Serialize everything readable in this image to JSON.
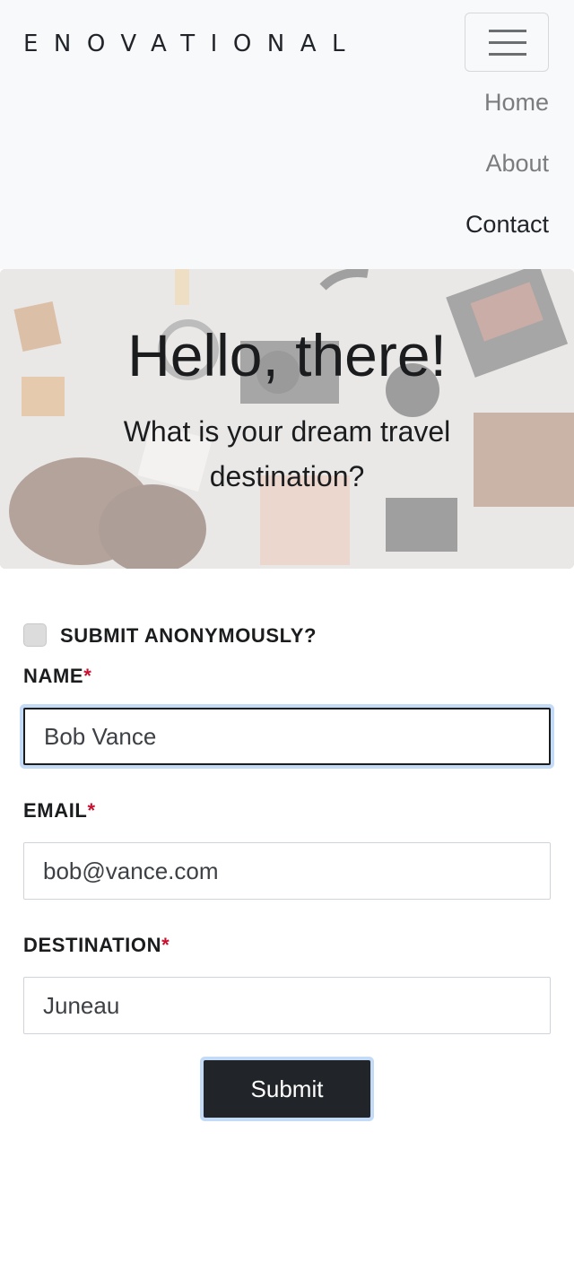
{
  "nav": {
    "brand": "ENOVATIONAL",
    "links": [
      "Home",
      "About",
      "Contact"
    ],
    "active_link": "Contact"
  },
  "hero": {
    "title": "Hello, there!",
    "subtitle": "What is your dream travel destination?"
  },
  "form": {
    "anonymous_label": "SUBMIT ANONYMOUSLY?",
    "anonymous_checked": false,
    "required_marker": "*",
    "name": {
      "label": "NAME",
      "value": "Bob Vance"
    },
    "email": {
      "label": "EMAIL",
      "value": "bob@vance.com"
    },
    "destination": {
      "label": "DESTINATION",
      "value": "Juneau"
    },
    "submit_label": "Submit"
  },
  "colors": {
    "required": "#c8102e",
    "button": "#212529",
    "focus_ring": "#c3dbf6"
  }
}
